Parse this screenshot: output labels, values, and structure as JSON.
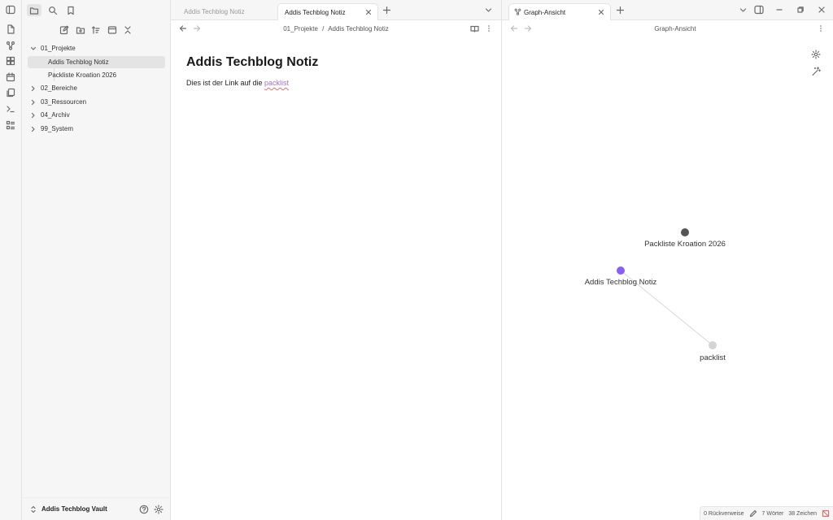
{
  "app": {
    "colors": {
      "accent": "#8b5cf6",
      "background": "#ffffff",
      "chrome": "#f6f6f6",
      "link": "#a173c6"
    }
  },
  "ribbon": {
    "icons": [
      "new-note-icon",
      "graph-icon",
      "canvas-icon",
      "daily-note-icon",
      "templates-icon",
      "command-palette-icon",
      "bases-icon"
    ]
  },
  "sidebar": {
    "tabs": [
      "files-icon",
      "search-icon",
      "bookmark-icon"
    ],
    "actions": [
      "new-note-icon",
      "new-folder-icon",
      "sort-icon",
      "collapse-icon",
      "close-all-icon"
    ],
    "tree": [
      {
        "label": "01_Projekte",
        "expanded": true
      },
      {
        "label": "Addis Techblog Notiz",
        "selected": true
      },
      {
        "label": "Packliste Kroation 2026"
      },
      {
        "label": "02_Bereiche"
      },
      {
        "label": "03_Ressourcen"
      },
      {
        "label": "04_Archiv"
      },
      {
        "label": "99_System"
      }
    ],
    "vault_name": "Addis Techblog Vault"
  },
  "left_pane": {
    "tabs": [
      {
        "label": "Addis Techblog Notiz",
        "active": false
      },
      {
        "label": "Addis Techblog Notiz",
        "active": true
      }
    ],
    "breadcrumb": {
      "folder": "01_Projekte",
      "separator": "/",
      "file": "Addis Techblog Notiz"
    },
    "note": {
      "title": "Addis Techblog Notiz",
      "body_prefix": "Dies ist der Link auf die ",
      "link_text": "packlist"
    }
  },
  "right_pane": {
    "tab_label": "Graph-Ansicht",
    "title": "Graph-Ansicht",
    "graph": {
      "nodes": [
        {
          "label": "Packliste Kroation 2026",
          "color": "#555555"
        },
        {
          "label": "Addis Techblog Notiz",
          "color": "#8b5cf6"
        },
        {
          "label": "packlist",
          "color": "#d4d4d4"
        }
      ],
      "edges": [
        [
          "Addis Techblog Notiz",
          "packlist"
        ]
      ]
    }
  },
  "statusbar": {
    "backlinks": "0 Rückverweise",
    "words": "7 Wörter",
    "chars": "38 Zeichen"
  }
}
